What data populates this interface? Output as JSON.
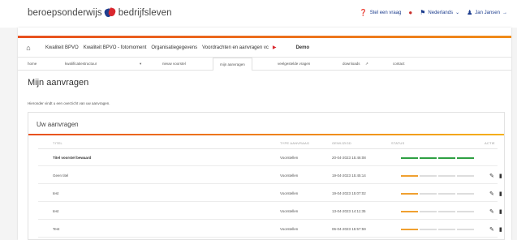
{
  "header": {
    "logo_left": "beroepsonderwijs",
    "logo_right": "bedrijfsleven",
    "help_label": "Stel een vraag",
    "language": "Nederlands",
    "user": "Jan Jansen"
  },
  "nav_primary": {
    "items": [
      "Kwaliteit BPVO",
      "Kwaliteit BPVO - fotomoment",
      "Organisatiegegevens",
      "Voordrachten en aanvragen vc"
    ],
    "context": "Demo"
  },
  "nav_secondary": {
    "items": [
      "home",
      "kwalificatiestructuur",
      "nieuw voorstel",
      "mijn aanvragen",
      "veelgestelde vragen",
      "downloads",
      "contact"
    ],
    "active": "mijn aanvragen"
  },
  "page": {
    "title": "Mijn aanvragen",
    "subtitle": "Hieronder vindt u een overzicht van uw aanvragen."
  },
  "panel": {
    "title": "Uw aanvragen",
    "columns": [
      "TITEL",
      "TYPE AANVRAAG",
      "GEWIJZIGD",
      "STATUS",
      "ACTIE"
    ],
    "rows": [
      {
        "title": "Titel voorstel bewaard",
        "type": "Voorstellen",
        "modified": "20-04-2023 15:46:08",
        "status": 4,
        "bold": true
      },
      {
        "title": "Geen titel",
        "type": "Voorstellen",
        "modified": "19-04-2023 15:45:14",
        "status": 1,
        "bold": false
      },
      {
        "title": "test",
        "type": "Voorstellen",
        "modified": "19-04-2023 15:07:02",
        "status": 1,
        "bold": false
      },
      {
        "title": "test",
        "type": "Voorstellen",
        "modified": "13-04-2023 14:11:35",
        "status": 1,
        "bold": false
      },
      {
        "title": "Test",
        "type": "Voorstellen",
        "modified": "06-04-2023 15:57:59",
        "status": 1,
        "bold": false
      }
    ],
    "status_total_steps": 4
  },
  "colors": {
    "brand_blue": "#1f3f8f",
    "brand_red": "#d9272e",
    "accent_orange": "#f0a030",
    "complete_green": "#2ea043"
  }
}
